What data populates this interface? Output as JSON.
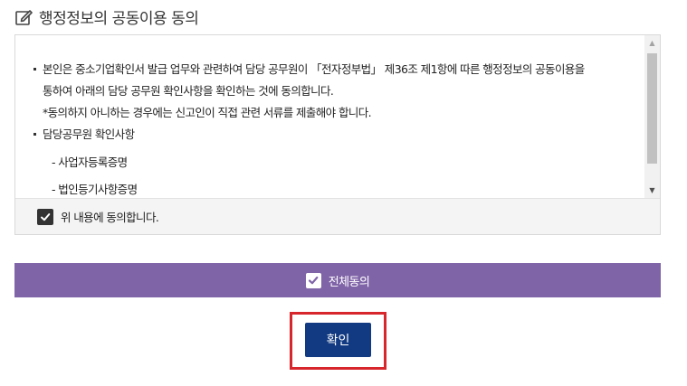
{
  "section": {
    "title": "행정정보의 공동이용 동의"
  },
  "consent": {
    "main_text_line1": "본인은 중소기업확인서 발급 업무와 관련하여 담당 공무원이 「전자정부법」 제36조 제1항에 따른 행정정보의 공동이용을",
    "main_text_line2": "통하여 아래의 담당 공무원 확인사항을 확인하는 것에 동의합니다.",
    "note": "*동의하지 아니하는 경우에는 신고인이 직접 관련 서류를 제출해야 합니다.",
    "items_heading": "담당공무원 확인사항",
    "documents": [
      "- 사업자등록증명",
      "- 법인등기사항증명"
    ]
  },
  "agree_row": {
    "checked": true,
    "label": "위 내용에 동의합니다."
  },
  "agree_all": {
    "checked": true,
    "label": "전체동의"
  },
  "confirm_button": {
    "label": "확인"
  },
  "colors": {
    "agree_all_bg": "#8064a8",
    "confirm_bg": "#123a82",
    "highlight_border": "#d7262c"
  }
}
